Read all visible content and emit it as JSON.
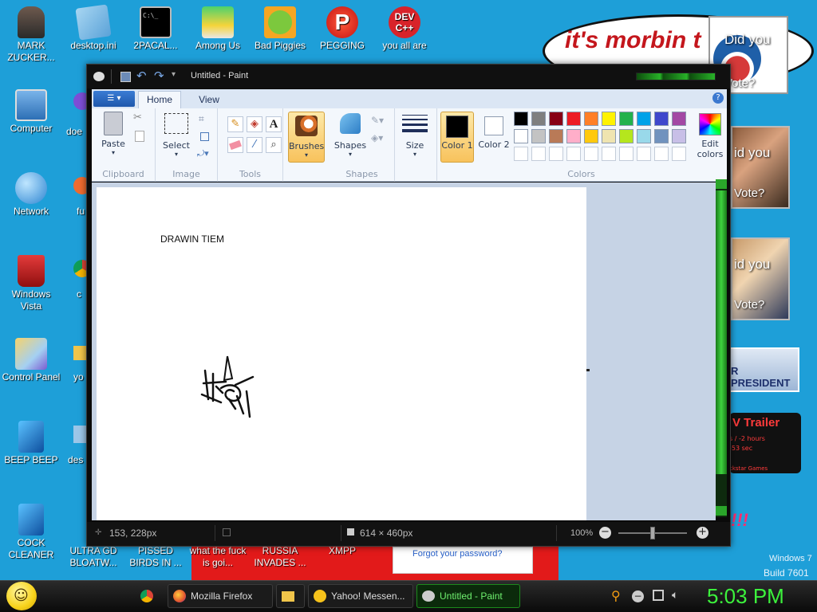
{
  "desktop": {
    "icons_left": [
      {
        "label": "MARK ZUCKER..."
      },
      {
        "label": "Computer"
      },
      {
        "label": "Network"
      },
      {
        "label": "Windows Vista"
      },
      {
        "label": "Control Panel"
      },
      {
        "label": "BEEP BEEP"
      },
      {
        "label": "COCK CLEANER"
      }
    ],
    "icons_top": [
      {
        "label": "desktop.ini"
      },
      {
        "label": "2PACAL..."
      },
      {
        "label": "Among Us"
      },
      {
        "label": "Bad Piggies"
      },
      {
        "label": "PEGGING"
      },
      {
        "label": "you all are"
      }
    ],
    "icons_bottom": [
      {
        "label": "ULTRA GD BLOATW..."
      },
      {
        "label": "PISSED BIRDS IN ..."
      },
      {
        "label": "what the fuck is goi..."
      },
      {
        "label": "RUSSIA INVADES ..."
      },
      {
        "label": "XMPP"
      }
    ],
    "partial_icons": [
      {
        "label": "doe"
      },
      {
        "label": "fu"
      },
      {
        "label": "c"
      },
      {
        "label": "yo"
      },
      {
        "label": "des"
      }
    ],
    "watermark": {
      "line1": "Windows 7",
      "line2": "Build 7601"
    }
  },
  "background": {
    "morbin_text": "it's morbin t",
    "did_you_vote_1": "Did you",
    "vote_1": "Vote?",
    "did_you_vote_2": "id you",
    "vote_2": "Vote?",
    "did_you_vote_3": "id you",
    "vote_3": "Vote?",
    "president": "R PRESIDENT",
    "trailer": "V Trailer",
    "trailer_sub1": "s / -2 hours",
    "trailer_sub2": "-53 sec",
    "trailer_sub3": "ckstar Games",
    "forgot": "Forgot your password?",
    "exclam": "!!!"
  },
  "paint": {
    "title": "Untitled - Paint",
    "tabs": {
      "home": "Home",
      "view": "View"
    },
    "groups": {
      "clipboard": "Clipboard",
      "image": "Image",
      "tools": "Tools",
      "shapes": "Shapes",
      "colors": "Colors"
    },
    "buttons": {
      "paste": "Paste",
      "select": "Select",
      "brushes": "Brushes",
      "shapes": "Shapes",
      "size": "Size",
      "color1": "Color 1",
      "color2": "Color 2",
      "edit_colors": "Edit colors"
    },
    "palette_row1": [
      "#000000",
      "#7f7f7f",
      "#880015",
      "#ed1c24",
      "#ff7f27",
      "#fff200",
      "#22b14c",
      "#00a2e8",
      "#3f48cc",
      "#a349a4"
    ],
    "palette_row2": [
      "#ffffff",
      "#c3c3c3",
      "#b97a57",
      "#ffaec9",
      "#ffc90e",
      "#efe4b0",
      "#b5e61d",
      "#99d9ea",
      "#7092be",
      "#c8bfe7"
    ],
    "canvas_text": "DRAWIN TIEM",
    "status": {
      "cursor": "153, 228px",
      "size": "614 × 460px",
      "zoom": "100%"
    }
  },
  "taskbar": {
    "items": [
      {
        "label": "",
        "name": "chrome"
      },
      {
        "label": "Mozilla Firefox",
        "name": "firefox"
      },
      {
        "label": "",
        "name": "folder"
      },
      {
        "label": "Yahoo! Messen...",
        "name": "yahoo"
      },
      {
        "label": "Untitled - Paint",
        "name": "paint"
      }
    ],
    "clock": "5:03 PM"
  }
}
